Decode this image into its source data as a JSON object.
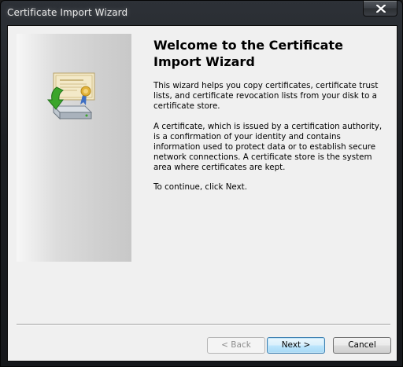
{
  "window": {
    "title": "Certificate Import Wizard"
  },
  "content": {
    "heading": "Welcome to the Certificate Import Wizard",
    "paragraph_1": "This wizard helps you copy certificates, certificate trust lists, and certificate revocation lists from your disk to a certificate store.",
    "paragraph_2": "A certificate, which is issued by a certification authority, is a confirmation of your identity and contains information used to protect data or to establish secure network connections. A certificate store is the system area where certificates are kept.",
    "paragraph_3": "To continue, click Next."
  },
  "buttons": {
    "back": "< Back",
    "next": "Next >",
    "cancel": "Cancel"
  },
  "icons": {
    "close": "close-icon",
    "wizard": "certificate-import-icon"
  },
  "colors": {
    "default_button_border": "#3c7fb1",
    "arrow_green": "#3aa52a"
  }
}
